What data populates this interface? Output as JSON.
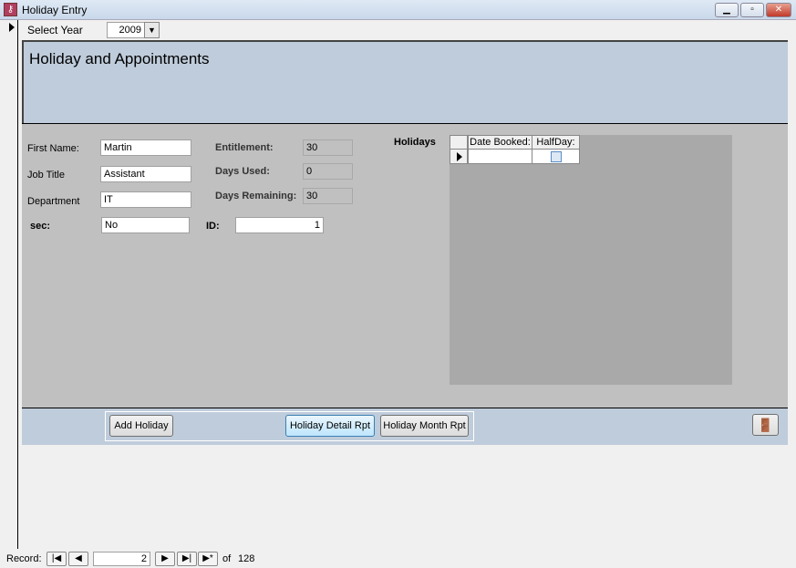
{
  "window": {
    "title": "Holiday Entry"
  },
  "filter": {
    "label": "Select Year",
    "value": "2009"
  },
  "header": {
    "title": "Holiday and Appointments"
  },
  "form": {
    "first_name_label": "First Name:",
    "first_name": "Martin",
    "job_title_label": "Job Title",
    "job_title": "Assistant",
    "department_label": "Department",
    "department": "IT",
    "sec_label": "sec:",
    "sec": "No",
    "entitlement_label": "Entitlement:",
    "entitlement": "30",
    "days_used_label": "Days Used:",
    "days_used": "0",
    "days_remaining_label": "Days Remaining:",
    "days_remaining": "30",
    "id_label": "ID:",
    "id": "1"
  },
  "holidays": {
    "label": "Holidays",
    "columns": [
      "Date Booked:",
      "HalfDay:"
    ]
  },
  "buttons": {
    "add": "Add Holiday",
    "detail": "Holiday Detail Rpt",
    "month": "Holiday Month Rpt"
  },
  "record_nav": {
    "label": "Record:",
    "current": "2",
    "of_label": "of",
    "total": "128"
  }
}
